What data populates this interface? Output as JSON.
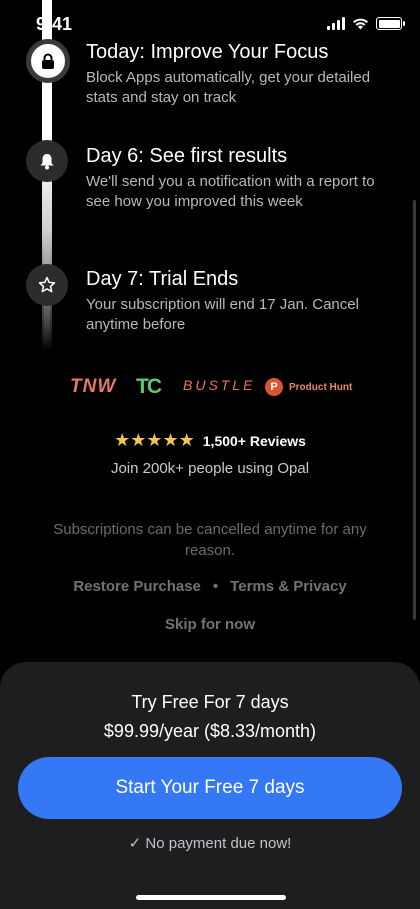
{
  "status_bar": {
    "time": "9:41"
  },
  "steps": [
    {
      "title": "Today: Improve Your Focus",
      "description": "Block Apps automatically, get your detailed stats and stay on track",
      "icon": "lock-icon"
    },
    {
      "title": "Day 6: See first results",
      "description": "We'll send you a notification with a report to see how you improved this week",
      "icon": "bell-icon"
    },
    {
      "title": "Day 7: Trial Ends",
      "description": "Your subscription will end 17 Jan. Cancel anytime before",
      "icon": "star-icon"
    }
  ],
  "press": {
    "tnw": "TNW",
    "tc": "TC",
    "bustle": "BUSTLE",
    "producthunt_badge": "P",
    "producthunt": "Product Hunt"
  },
  "social": {
    "stars": "★★★★★",
    "reviews": "1,500+ Reviews",
    "join": "Join 200k+ people using Opal"
  },
  "footer": {
    "cancel_note": "Subscriptions can be cancelled anytime for any reason.",
    "restore": "Restore Purchase",
    "separator": "•",
    "terms": "Terms & Privacy",
    "skip": "Skip for now"
  },
  "offer": {
    "title": "Try Free For 7 days",
    "price": "$99.99/year ($8.33/month)",
    "cta": "Start Your Free 7 days",
    "check": "✓",
    "no_payment": "No payment due now!"
  },
  "colors": {
    "accent": "#3478f6",
    "stars": "#f5c451",
    "sheet": "#1e1e20"
  }
}
